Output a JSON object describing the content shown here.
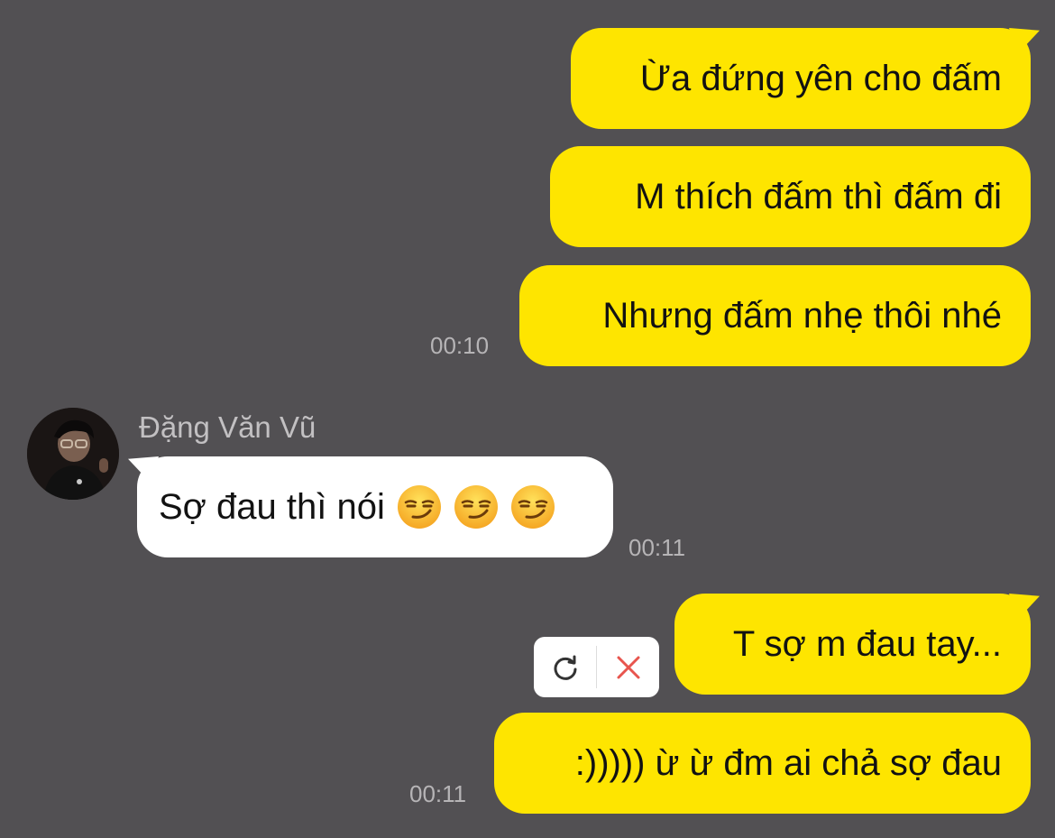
{
  "conversation": {
    "outgoing_group_1": {
      "messages": [
        {
          "text": "Ừa đứng yên cho đấm"
        },
        {
          "text": "M thích đấm thì đấm đi"
        },
        {
          "text": "Nhưng đấm nhẹ thôi nhé"
        }
      ],
      "time": "00:10"
    },
    "incoming_group": {
      "sender_name": "Đặng Văn Vũ",
      "avatar_icon": "person-photo-avatar",
      "messages": [
        {
          "text": "Sợ đau thì nói",
          "emojis": [
            "smirking-face-icon",
            "smirking-face-icon",
            "smirking-face-icon"
          ]
        }
      ],
      "time": "00:11"
    },
    "outgoing_group_2": {
      "messages": [
        {
          "text": "T sợ m đau tay..."
        },
        {
          "text": ":))))) ừ ừ đm ai chả sợ đau"
        }
      ],
      "time": "00:11",
      "failed_message_actions": [
        "retry-icon",
        "delete-icon"
      ]
    }
  },
  "colors": {
    "background": "#525053",
    "outgoing_bubble": "#fee500",
    "incoming_bubble": "#ffffff",
    "timestamp": "#b6b4b6",
    "delete_icon": "#e8554e"
  }
}
